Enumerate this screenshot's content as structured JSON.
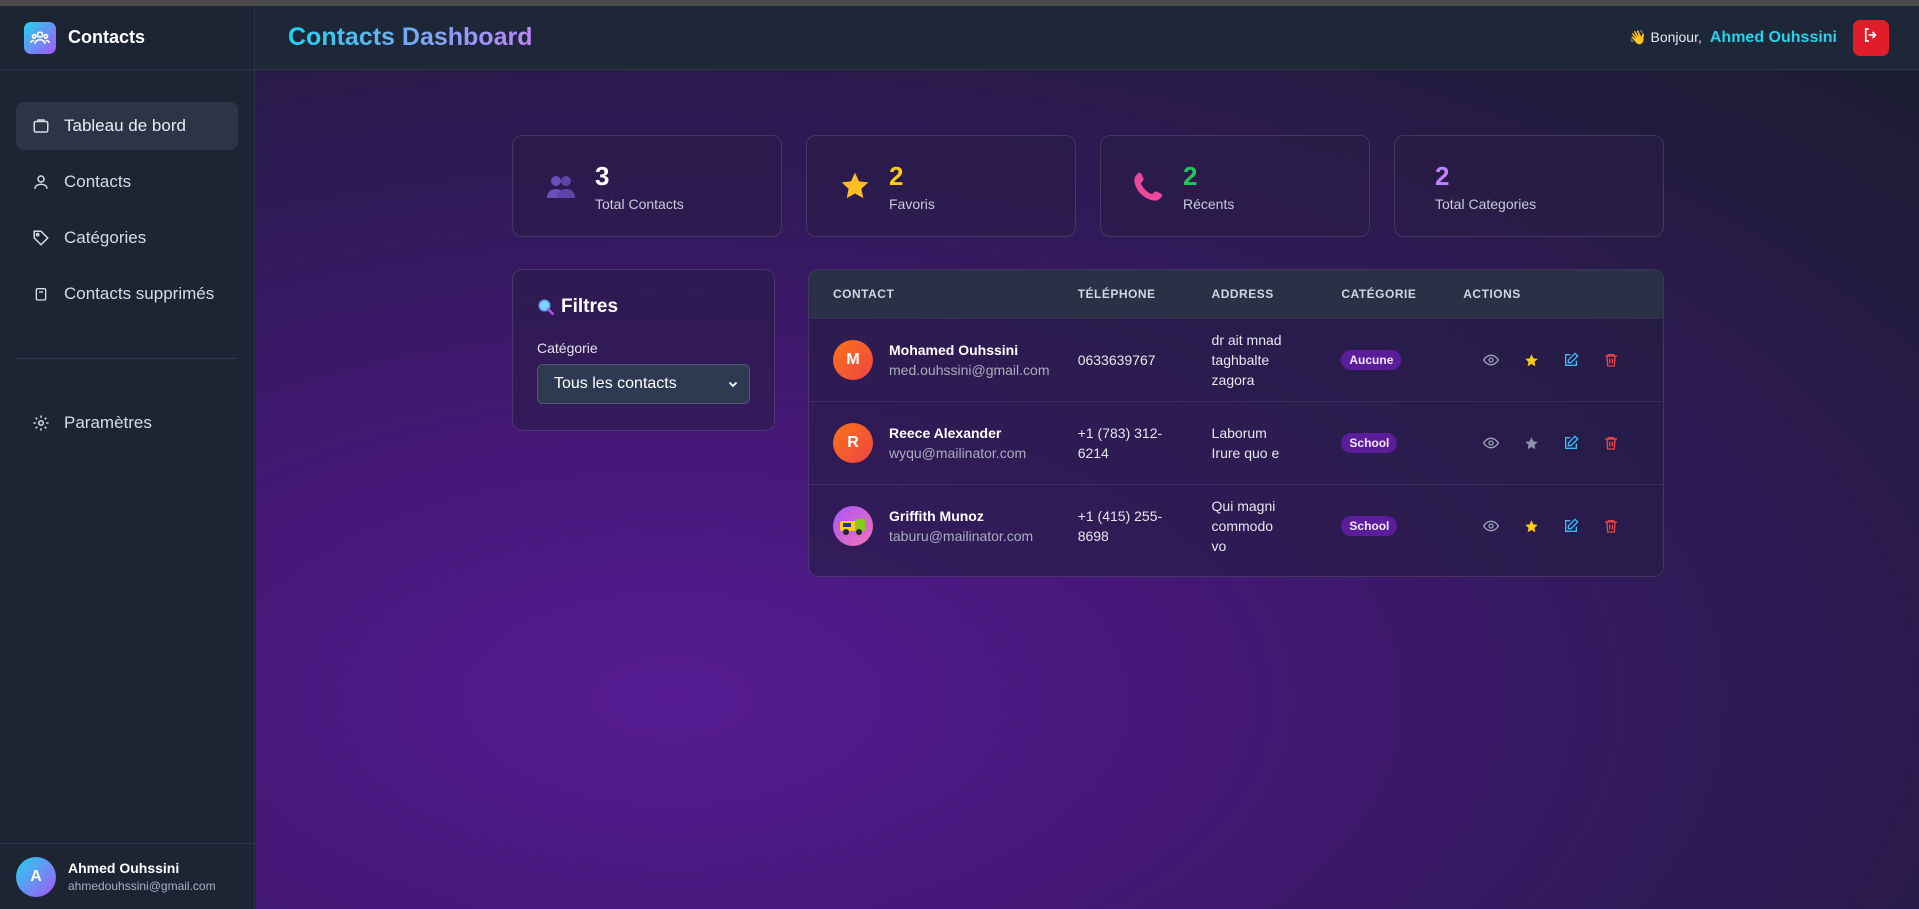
{
  "app": {
    "title": "Contacts"
  },
  "sidebar": {
    "items": [
      {
        "label": "Tableau de bord",
        "icon": "dashboard-icon"
      },
      {
        "label": "Contacts",
        "icon": "user-icon"
      },
      {
        "label": "Catégories",
        "icon": "tag-icon"
      },
      {
        "label": "Contacts supprimés",
        "icon": "trash-icon"
      },
      {
        "label": "Paramètres",
        "icon": "gear-icon"
      }
    ],
    "user": {
      "initial": "A",
      "name": "Ahmed Ouhssini",
      "email": "ahmedouhssini@gmail.com"
    }
  },
  "header": {
    "title": "Contacts Dashboard",
    "greeting": "👋 Bonjour,",
    "user_name": "Ahmed Ouhssini"
  },
  "stats": [
    {
      "value": "3",
      "label": "Total Contacts",
      "color": "#ffffff",
      "icon": "users-icon"
    },
    {
      "value": "2",
      "label": "Favoris",
      "color": "#facc15",
      "icon": "star-icon"
    },
    {
      "value": "2",
      "label": "Récents",
      "color": "#22c55e",
      "icon": "phone-icon"
    },
    {
      "value": "2",
      "label": "Total Categories",
      "color": "#c084fc",
      "icon": ""
    }
  ],
  "filters": {
    "title": "Filtres",
    "category_label": "Catégorie",
    "category_value": "Tous les contacts"
  },
  "table": {
    "headers": [
      "CONTACT",
      "TÉLÉPHONE",
      "ADDRESS",
      "CATÉGORIE",
      "ACTIONS"
    ],
    "rows": [
      {
        "initial": "M",
        "name": "Mohamed Ouhssini",
        "email": "med.ouhssini@gmail.com",
        "phone_lines": [
          "0633639767"
        ],
        "address_lines": [
          "dr ait mnad",
          "taghbalte",
          "zagora"
        ],
        "category": "Aucune",
        "favorite": true
      },
      {
        "initial": "R",
        "name": "Reece Alexander",
        "email": "wyqu@mailinator.com",
        "phone_lines": [
          "+1 (783) 312-",
          "6214"
        ],
        "address_lines": [
          "Laborum",
          "Irure quo e"
        ],
        "category": "School",
        "favorite": false
      },
      {
        "initial": "",
        "name": "Griffith Munoz",
        "email": "taburu@mailinator.com",
        "phone_lines": [
          "+1 (415) 255-",
          "8698"
        ],
        "address_lines": [
          "Qui magni",
          "commodo",
          "vo"
        ],
        "category": "School",
        "favorite": true
      }
    ]
  },
  "colors": {
    "accent": "#22d3ee",
    "danger": "#e11d2a",
    "purple": "#a855f7"
  }
}
